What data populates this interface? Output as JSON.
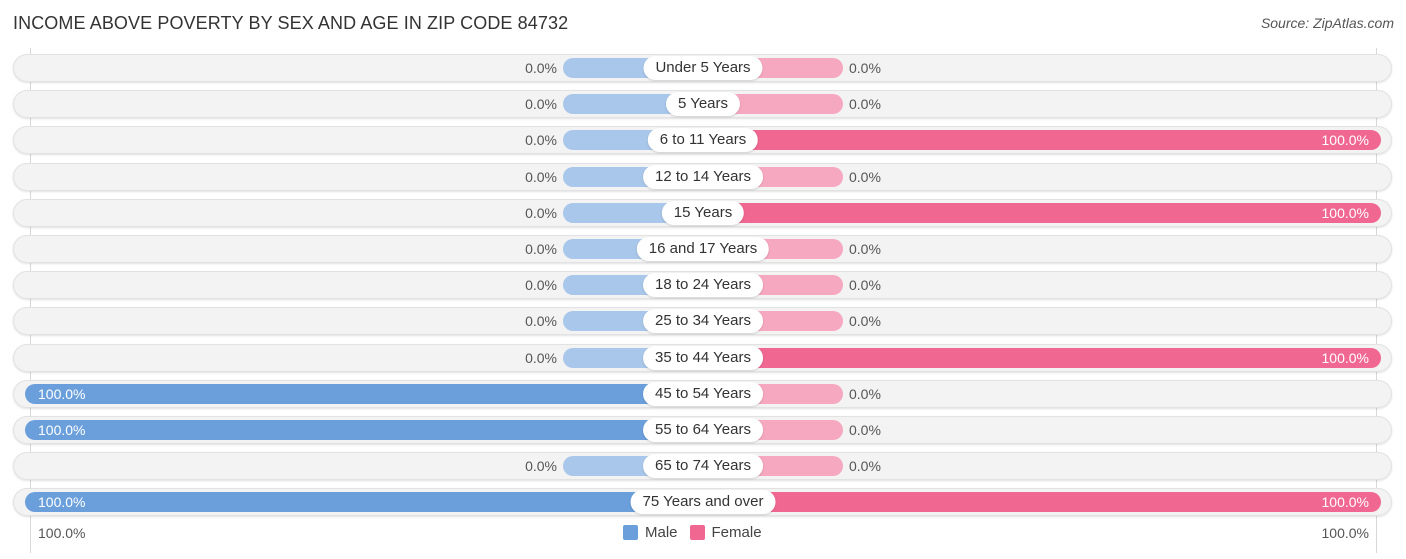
{
  "header": {
    "title": "INCOME ABOVE POVERTY BY SEX AND AGE IN ZIP CODE 84732",
    "source": "Source: ZipAtlas.com"
  },
  "colors": {
    "male": "#6a9fdb",
    "male_zero": "#a9c7ea",
    "female": "#f06892",
    "female_zero": "#f6a8c0",
    "track": "#f3f3f3"
  },
  "chart_data": {
    "type": "bar",
    "orientation": "horizontal-diverging",
    "title": "INCOME ABOVE POVERTY BY SEX AND AGE IN ZIP CODE 84732",
    "xlabel": "",
    "ylabel": "",
    "xlim": [
      0,
      100
    ],
    "axis_labels": {
      "left": "100.0%",
      "right": "100.0%"
    },
    "legend_position": "bottom-center",
    "categories": [
      "Under 5 Years",
      "5 Years",
      "6 to 11 Years",
      "12 to 14 Years",
      "15 Years",
      "16 and 17 Years",
      "18 to 24 Years",
      "25 to 34 Years",
      "35 to 44 Years",
      "45 to 54 Years",
      "55 to 64 Years",
      "65 to 74 Years",
      "75 Years and over"
    ],
    "series": [
      {
        "name": "Male",
        "values": [
          0,
          0,
          0,
          0,
          0,
          0,
          0,
          0,
          0,
          100,
          100,
          0,
          100
        ],
        "labels": [
          "0.0%",
          "0.0%",
          "0.0%",
          "0.0%",
          "0.0%",
          "0.0%",
          "0.0%",
          "0.0%",
          "0.0%",
          "100.0%",
          "100.0%",
          "0.0%",
          "100.0%"
        ]
      },
      {
        "name": "Female",
        "values": [
          0,
          0,
          100,
          0,
          100,
          0,
          0,
          0,
          100,
          0,
          0,
          0,
          100
        ],
        "labels": [
          "0.0%",
          "0.0%",
          "100.0%",
          "0.0%",
          "100.0%",
          "0.0%",
          "0.0%",
          "0.0%",
          "100.0%",
          "0.0%",
          "0.0%",
          "0.0%",
          "100.0%"
        ]
      }
    ]
  },
  "legend": {
    "male_label": "Male",
    "female_label": "Female"
  }
}
